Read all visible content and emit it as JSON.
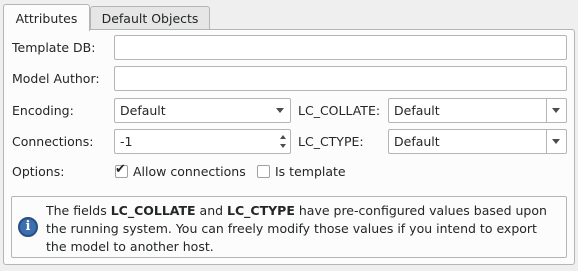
{
  "tabs": [
    {
      "label": "Attributes"
    },
    {
      "label": "Default Objects"
    }
  ],
  "form": {
    "template_db": {
      "label": "Template DB:",
      "value": ""
    },
    "model_author": {
      "label": "Model Author:",
      "value": ""
    },
    "encoding": {
      "label": "Encoding:",
      "value": "Default"
    },
    "lc_collate": {
      "label": "LC_COLLATE:",
      "value": "Default"
    },
    "connections": {
      "label": "Connections:",
      "value": "-1"
    },
    "lc_ctype": {
      "label": "LC_CTYPE:",
      "value": "Default"
    },
    "options": {
      "label": "Options:",
      "allow_connections": {
        "label": "Allow connections",
        "checked": true
      },
      "is_template": {
        "label": "Is template",
        "checked": false
      }
    }
  },
  "info": {
    "icon": "info-icon",
    "text_1": "The fields ",
    "bold_1": "LC_COLLATE",
    "text_2": " and ",
    "bold_2": "LC_CTYPE",
    "text_3": " have pre-configured values based upon the running system. You can freely modify those values if you intend to export the model to another host."
  }
}
